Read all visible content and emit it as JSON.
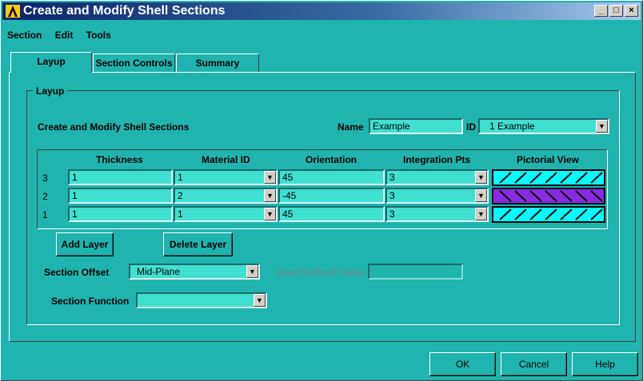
{
  "window": {
    "title": "Create and Modify Shell Sections"
  },
  "menu": [
    "Section",
    "Edit",
    "Tools"
  ],
  "tabs": [
    "Layup",
    "Section Controls",
    "Summary"
  ],
  "group_label": "Layup",
  "heading": "Create and Modify Shell Sections",
  "name_label": "Name",
  "name_value": "Example",
  "id_label": "ID",
  "id_value": "1   Example",
  "table": {
    "headers": [
      "Thickness",
      "Material ID",
      "Orientation",
      "Integration Pts",
      "Pictorial View"
    ],
    "rows": [
      {
        "num": "3",
        "thickness": "1",
        "material": "1",
        "orientation": "45",
        "integration": "3",
        "color": "#00ffff",
        "hatch": "forward"
      },
      {
        "num": "2",
        "thickness": "1",
        "material": "2",
        "orientation": "-45",
        "integration": "3",
        "color": "#8a2be2",
        "hatch": "back"
      },
      {
        "num": "1",
        "thickness": "1",
        "material": "1",
        "orientation": "45",
        "integration": "3",
        "color": "#00ffff",
        "hatch": "forward"
      }
    ]
  },
  "add_layer": "Add Layer",
  "delete_layer": "Delete Layer",
  "offset_label": "Section Offset",
  "offset_value": "Mid-Plane",
  "user_value_label": "Used Defined Value",
  "function_label": "Section Function",
  "function_value": "",
  "buttons": {
    "ok": "OK",
    "cancel": "Cancel",
    "help": "Help"
  }
}
